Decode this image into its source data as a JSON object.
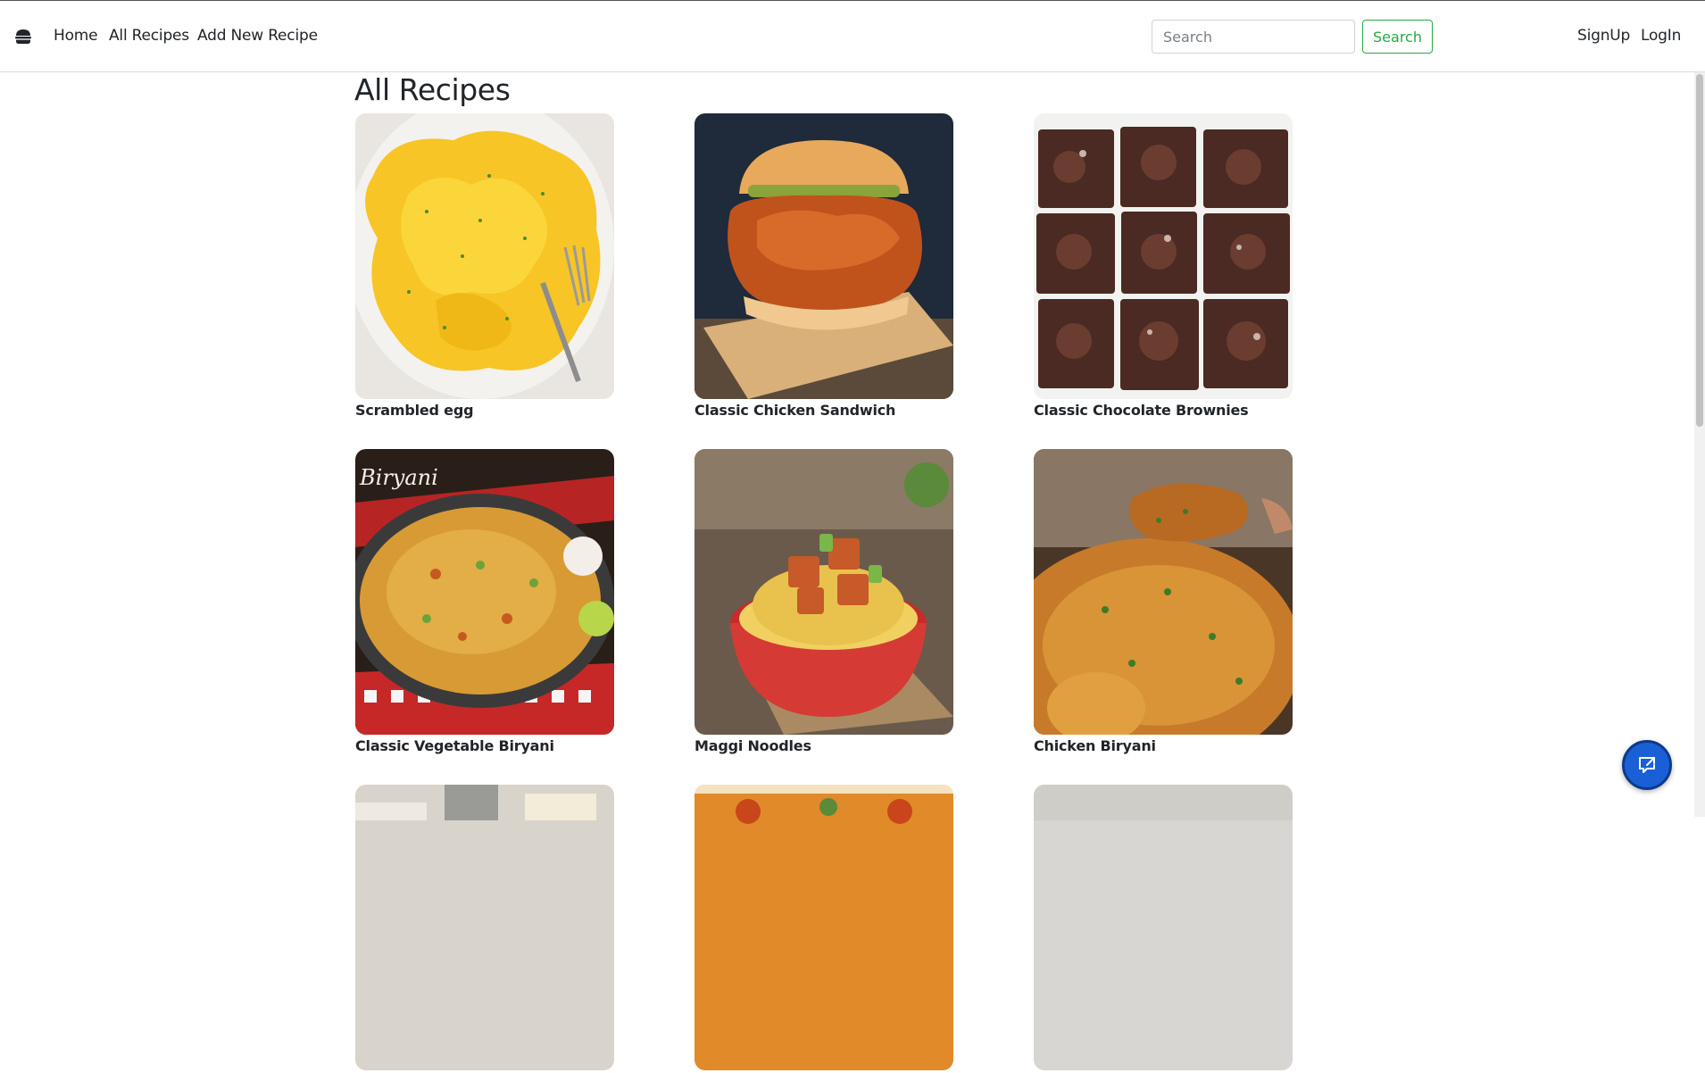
{
  "navbar": {
    "logo_icon": "burger-icon",
    "links": [
      "Home",
      "All Recipes",
      "Add New Recipe"
    ],
    "search": {
      "placeholder": "Search",
      "value": "",
      "button_label": "Search"
    },
    "auth": {
      "signup_label": "SignUp",
      "login_label": "LogIn"
    }
  },
  "main": {
    "title": "All Recipes",
    "recipes": [
      {
        "title": "Scrambled egg",
        "image": "scrambled-egg-photo"
      },
      {
        "title": "Classic Chicken Sandwich",
        "image": "chicken-sandwich-photo"
      },
      {
        "title": "Classic Chocolate Brownies",
        "image": "brownies-photo"
      },
      {
        "title": "Classic Vegetable Biryani",
        "image": "vegetable-biryani-photo"
      },
      {
        "title": "Maggi Noodles",
        "image": "maggi-noodles-photo"
      },
      {
        "title": "Chicken Biryani",
        "image": "chicken-biryani-photo"
      },
      {
        "title": "",
        "image": "paneer-dish-photo"
      },
      {
        "title": "",
        "image": "pizza-photo"
      },
      {
        "title": "",
        "image": "dish-photo"
      }
    ]
  },
  "floating_button": {
    "icon": "chat-icon"
  },
  "colors": {
    "accent_green": "#28a745",
    "fab_blue": "#1a5fd6",
    "text": "#212529"
  }
}
